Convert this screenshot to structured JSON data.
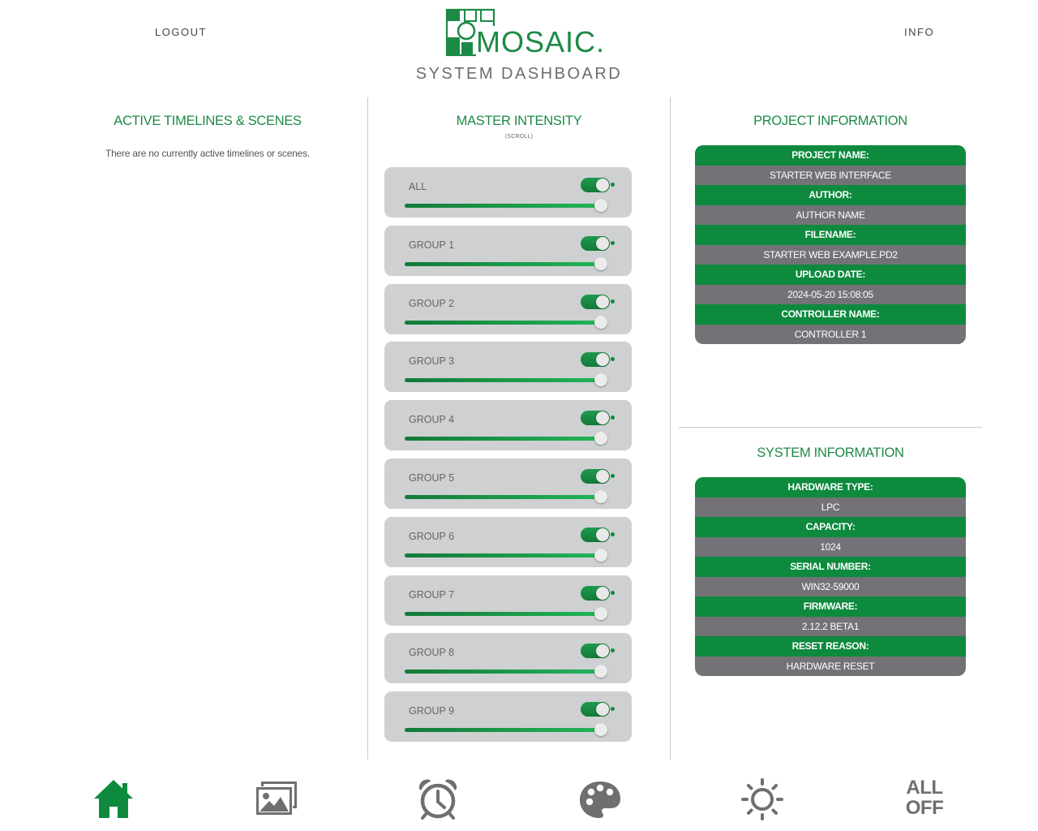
{
  "header": {
    "logout_label": "LOGOUT",
    "info_label": "INFO",
    "brand": "MOSAIC.",
    "dashboard_title": "SYSTEM DASHBOARD"
  },
  "active": {
    "title": "ACTIVE TIMELINES & SCENES",
    "empty_message": "There are no currently active timelines or scenes."
  },
  "master": {
    "title": "MASTER INTENSITY",
    "scroll_note": "(SCROLL)",
    "groups": [
      {
        "label": "ALL",
        "on": true,
        "level": 1.0
      },
      {
        "label": "GROUP 1",
        "on": true,
        "level": 1.0
      },
      {
        "label": "GROUP 2",
        "on": true,
        "level": 1.0
      },
      {
        "label": "GROUP 3",
        "on": true,
        "level": 1.0
      },
      {
        "label": "GROUP 4",
        "on": true,
        "level": 1.0
      },
      {
        "label": "GROUP 5",
        "on": true,
        "level": 1.0
      },
      {
        "label": "GROUP 6",
        "on": true,
        "level": 1.0
      },
      {
        "label": "GROUP 7",
        "on": true,
        "level": 1.0
      },
      {
        "label": "GROUP 8",
        "on": true,
        "level": 1.0
      },
      {
        "label": "GROUP 9",
        "on": true,
        "level": 1.0
      }
    ]
  },
  "project": {
    "title": "PROJECT INFORMATION",
    "rows": [
      {
        "key": "PROJECT NAME:",
        "value": "STARTER WEB INTERFACE"
      },
      {
        "key": "AUTHOR:",
        "value": "AUTHOR NAME"
      },
      {
        "key": "FILENAME:",
        "value": "STARTER WEB EXAMPLE.PD2"
      },
      {
        "key": "UPLOAD DATE:",
        "value": "2024-05-20 15:08:05"
      },
      {
        "key": "CONTROLLER NAME:",
        "value": "CONTROLLER 1"
      }
    ]
  },
  "system": {
    "title": "SYSTEM INFORMATION",
    "rows": [
      {
        "key": "HARDWARE TYPE:",
        "value": "LPC"
      },
      {
        "key": "CAPACITY:",
        "value": "1024"
      },
      {
        "key": "SERIAL NUMBER:",
        "value": "WIN32-59000"
      },
      {
        "key": "FIRMWARE:",
        "value": "2.12.2 BETA1"
      },
      {
        "key": "RESET REASON:",
        "value": "HARDWARE RESET"
      }
    ]
  },
  "bottom_nav": {
    "items": [
      {
        "icon": "home-icon",
        "active": true
      },
      {
        "icon": "scenes-icon",
        "active": false
      },
      {
        "icon": "alarm-clock-icon",
        "active": false
      },
      {
        "icon": "palette-icon",
        "active": false
      },
      {
        "icon": "sun-icon",
        "active": false
      }
    ],
    "all_off_line1": "ALL",
    "all_off_line2": "OFF"
  },
  "colors": {
    "brand_green": "#1c8a45",
    "key_row_green": "#0d8a3e",
    "value_row_gray": "#737377",
    "card_gray": "#cfd0d2",
    "icon_gray": "#6f6f6f"
  }
}
